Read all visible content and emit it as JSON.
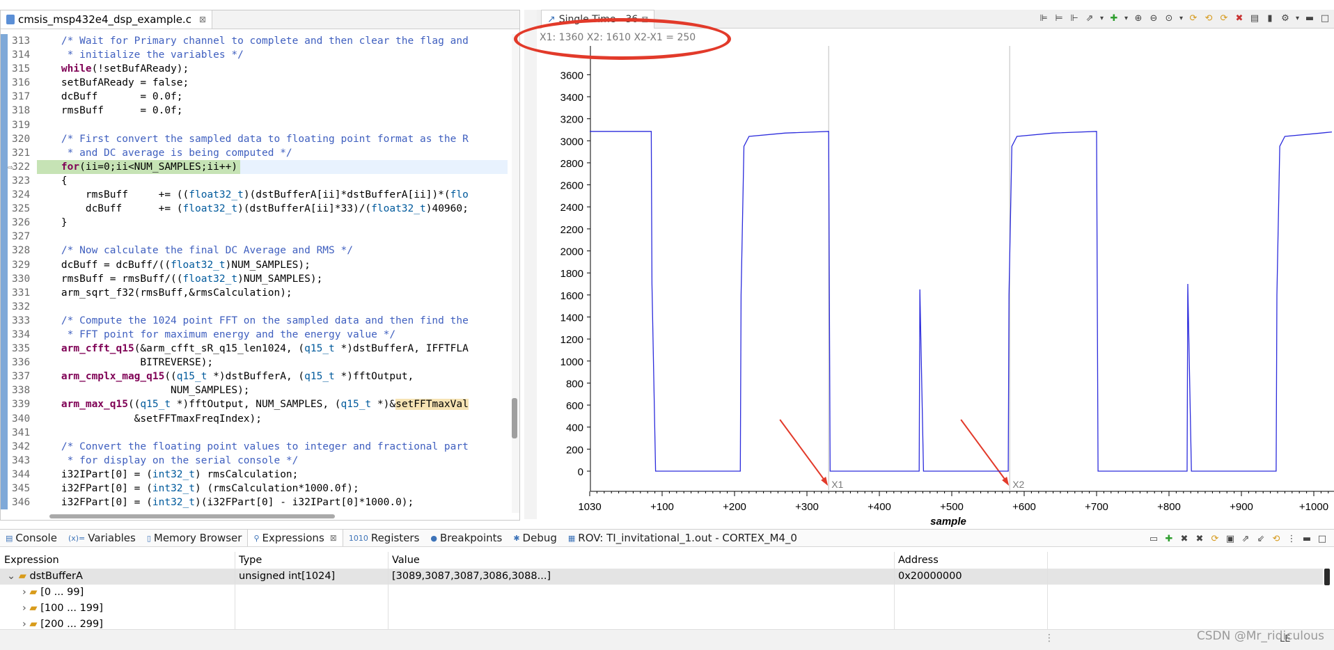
{
  "editor": {
    "tab_title": "cmsis_msp432e4_dsp_example.c",
    "tab_close": "⊠",
    "lines": [
      {
        "n": "313",
        "parts": [
          [
            "cmt",
            "    /* Wait for Primary channel to complete and then clear the flag and"
          ]
        ]
      },
      {
        "n": "314",
        "parts": [
          [
            "cmt",
            "     * initialize the variables */"
          ]
        ]
      },
      {
        "n": "315",
        "parts": [
          [
            "kw",
            "    while"
          ],
          [
            "",
            "(!setBufAReady);"
          ]
        ]
      },
      {
        "n": "316",
        "parts": [
          [
            "",
            "    setBufAReady = false;"
          ]
        ]
      },
      {
        "n": "317",
        "parts": [
          [
            "",
            "    dcBuff       = 0.0f;"
          ]
        ]
      },
      {
        "n": "318",
        "parts": [
          [
            "",
            "    rmsBuff      = 0.0f;"
          ]
        ]
      },
      {
        "n": "319",
        "parts": [
          [
            "",
            ""
          ]
        ]
      },
      {
        "n": "320",
        "parts": [
          [
            "cmt",
            "    /* First convert the sampled data to floating point format as the R"
          ]
        ]
      },
      {
        "n": "321",
        "parts": [
          [
            "cmt",
            "     * and DC average is being computed */"
          ]
        ]
      },
      {
        "n": "322",
        "hl": true,
        "parts": [
          [
            "kw",
            "    for"
          ],
          [
            "",
            "(ii=0;ii<NUM_SAMPLES;ii++)"
          ]
        ]
      },
      {
        "n": "323",
        "parts": [
          [
            "",
            "    {"
          ]
        ]
      },
      {
        "n": "324",
        "parts": [
          [
            "",
            "        rmsBuff     += (("
          ],
          [
            "ty",
            "float32_t"
          ],
          [
            "",
            ")(dstBufferA[ii]*dstBufferA[ii])*("
          ],
          [
            "ty",
            "flo"
          ]
        ]
      },
      {
        "n": "325",
        "parts": [
          [
            "",
            "        dcBuff      += ("
          ],
          [
            "ty",
            "float32_t"
          ],
          [
            "",
            ")(dstBufferA[ii]*33)/("
          ],
          [
            "ty",
            "float32_t"
          ],
          [
            "",
            ")40960;"
          ]
        ]
      },
      {
        "n": "326",
        "parts": [
          [
            "",
            "    }"
          ]
        ]
      },
      {
        "n": "327",
        "parts": [
          [
            "",
            ""
          ]
        ]
      },
      {
        "n": "328",
        "parts": [
          [
            "cmt",
            "    /* Now calculate the final DC Average and RMS */"
          ]
        ]
      },
      {
        "n": "329",
        "parts": [
          [
            "",
            "    dcBuff = dcBuff/(("
          ],
          [
            "ty",
            "float32_t"
          ],
          [
            "",
            ")NUM_SAMPLES);"
          ]
        ]
      },
      {
        "n": "330",
        "parts": [
          [
            "",
            "    rmsBuff = rmsBuff/(("
          ],
          [
            "ty",
            "float32_t"
          ],
          [
            "",
            ")NUM_SAMPLES);"
          ]
        ]
      },
      {
        "n": "331",
        "parts": [
          [
            "",
            "    arm_sqrt_f32(rmsBuff,&rmsCalculation);"
          ]
        ]
      },
      {
        "n": "332",
        "parts": [
          [
            "",
            ""
          ]
        ]
      },
      {
        "n": "333",
        "parts": [
          [
            "cmt",
            "    /* Compute the 1024 point FFT on the sampled data and then find the"
          ]
        ]
      },
      {
        "n": "334",
        "parts": [
          [
            "cmt",
            "     * FFT point for maximum energy and the energy value */"
          ]
        ]
      },
      {
        "n": "335",
        "parts": [
          [
            "kw",
            "    arm_cfft_q15"
          ],
          [
            "",
            "(&arm_cfft_sR_q15_len1024, ("
          ],
          [
            "ty",
            "q15_t"
          ],
          [
            "",
            " *)dstBufferA, IFFTFLA"
          ]
        ]
      },
      {
        "n": "336",
        "parts": [
          [
            "",
            "                 BITREVERSE);"
          ]
        ]
      },
      {
        "n": "337",
        "parts": [
          [
            "kw",
            "    arm_cmplx_mag_q15"
          ],
          [
            "",
            "(("
          ],
          [
            "ty",
            "q15_t"
          ],
          [
            "",
            " *)dstBufferA, ("
          ],
          [
            "ty",
            "q15_t"
          ],
          [
            "",
            " *)fftOutput,"
          ]
        ]
      },
      {
        "n": "338",
        "parts": [
          [
            "",
            "                      NUM_SAMPLES);"
          ]
        ]
      },
      {
        "n": "339",
        "parts": [
          [
            "kw",
            "    arm_max_q15"
          ],
          [
            "",
            "(("
          ],
          [
            "ty",
            "q15_t"
          ],
          [
            "",
            " *)fftOutput, NUM_SAMPLES, ("
          ],
          [
            "ty",
            "q15_t"
          ],
          [
            "",
            " *)&"
          ],
          [
            "mark",
            "setFFTmaxVal"
          ]
        ]
      },
      {
        "n": "340",
        "parts": [
          [
            "",
            "                &setFFTmaxFreqIndex);"
          ]
        ]
      },
      {
        "n": "341",
        "parts": [
          [
            "",
            ""
          ]
        ]
      },
      {
        "n": "342",
        "parts": [
          [
            "cmt",
            "    /* Convert the floating point values to integer and fractional part"
          ]
        ]
      },
      {
        "n": "343",
        "parts": [
          [
            "cmt",
            "     * for display on the serial console */"
          ]
        ]
      },
      {
        "n": "344",
        "parts": [
          [
            "",
            "    i32IPart[0] = ("
          ],
          [
            "ty",
            "int32_t"
          ],
          [
            "",
            ") rmsCalculation;"
          ]
        ]
      },
      {
        "n": "345",
        "parts": [
          [
            "",
            "    i32FPart[0] = ("
          ],
          [
            "ty",
            "int32_t"
          ],
          [
            "",
            ") (rmsCalculation*1000.0f);"
          ]
        ]
      },
      {
        "n": "346",
        "parts": [
          [
            "",
            "    i32FPart[0] = ("
          ],
          [
            "ty",
            "int32_t"
          ],
          [
            "",
            ")(i32FPart[0] - i32IPart[0]*1000.0);"
          ]
        ]
      }
    ]
  },
  "graph": {
    "tab_title": "Single Time - 36",
    "tab_close": "⊠",
    "status_text": "X1: 1360   X2: 1610   X2-X1 = 250",
    "cursor1_label": "X1",
    "cursor2_label": "X2",
    "xlabel": "sample",
    "toolbar_icons": [
      "align-left-icon",
      "align-center-icon",
      "align-right-icon",
      "export-icon",
      "dropdown-icon",
      "add-icon",
      "dropdown-icon",
      "zoom-in-icon",
      "zoom-out-icon",
      "zoom-fit-icon",
      "dropdown-icon",
      "refresh-icon",
      "sync-icon",
      "refresh-multi-icon",
      "remove-icon",
      "display-icon",
      "pin-icon",
      "properties-icon",
      "dropdown-icon",
      "minimize-icon",
      "maximize-icon"
    ]
  },
  "chart_data": {
    "type": "line",
    "title": "",
    "xlabel": "sample",
    "ylabel": "",
    "xlim": [
      1030,
      1055
    ],
    "ylim": [
      0,
      3650
    ],
    "x_ticks": [
      "1030",
      "+100",
      "+200",
      "+300",
      "+400",
      "+500",
      "+600",
      "+700",
      "+800",
      "+900",
      "+1000"
    ],
    "y_ticks": [
      0,
      200,
      400,
      600,
      800,
      1000,
      1200,
      1400,
      1600,
      1800,
      2000,
      2200,
      2400,
      2600,
      2800,
      3000,
      3200,
      3400,
      3600
    ],
    "cursors": [
      {
        "label": "X1",
        "x": 1360
      },
      {
        "label": "X2",
        "x": 1610
      }
    ],
    "series": [
      {
        "color": "#2b2bdc",
        "x": [
          1030,
          1115,
          1116,
          1121,
          1122,
          1238,
          1239,
          1243,
          1250,
          1300,
          1360,
          1362,
          1485,
          1486,
          1491,
          1492,
          1608,
          1609,
          1613,
          1620,
          1670,
          1730,
          1732,
          1855,
          1856,
          1861,
          1862,
          1978,
          1979,
          1983,
          1990,
          2040,
          2055
        ],
        "values": [
          3085,
          3085,
          1700,
          0,
          0,
          0,
          1600,
          2950,
          3040,
          3070,
          3085,
          0,
          0,
          1650,
          0,
          0,
          0,
          1600,
          2950,
          3040,
          3070,
          3085,
          0,
          0,
          1700,
          0,
          0,
          0,
          1600,
          2950,
          3040,
          3070,
          3080
        ]
      }
    ],
    "grid": false,
    "legend": "none"
  },
  "bottom": {
    "tabs": [
      {
        "label": "Console",
        "icon": "console-icon"
      },
      {
        "label": "Variables",
        "icon": "variables-icon"
      },
      {
        "label": "Memory Browser",
        "icon": "memory-icon"
      },
      {
        "label": "Expressions",
        "icon": "expressions-icon",
        "active": true
      },
      {
        "label": "Registers",
        "icon": "registers-icon"
      },
      {
        "label": "Breakpoints",
        "icon": "breakpoints-icon"
      },
      {
        "label": "Debug",
        "icon": "debug-icon"
      },
      {
        "label": "ROV: TI_invitational_1.out - CORTEX_M4_0",
        "icon": "rov-icon"
      }
    ],
    "columns": [
      "Expression",
      "Type",
      "Value",
      "Address"
    ],
    "rows": [
      {
        "expr": "dstBufferA",
        "type": "unsigned int[1024]",
        "value": "[3089,3087,3087,3086,3088...]",
        "address": "0x20000000",
        "expanded": true,
        "selected": true
      },
      {
        "expr": "[0 ... 99]",
        "type": "",
        "value": "",
        "address": "",
        "child": true
      },
      {
        "expr": "[100 ... 199]",
        "type": "",
        "value": "",
        "address": "",
        "child": true
      },
      {
        "expr": "[200 ... 299]",
        "type": "",
        "value": "",
        "address": "",
        "child": true
      }
    ]
  },
  "status_bar": {
    "lang": "LE"
  },
  "watermark": "CSDN @Mr_ridiculous",
  "colors": {
    "accent_red": "#e23a2a",
    "signal_blue": "#2b2bdc",
    "code_comment": "#3f5fbf",
    "keyword": "#7f0055",
    "type": "#005a9c"
  }
}
